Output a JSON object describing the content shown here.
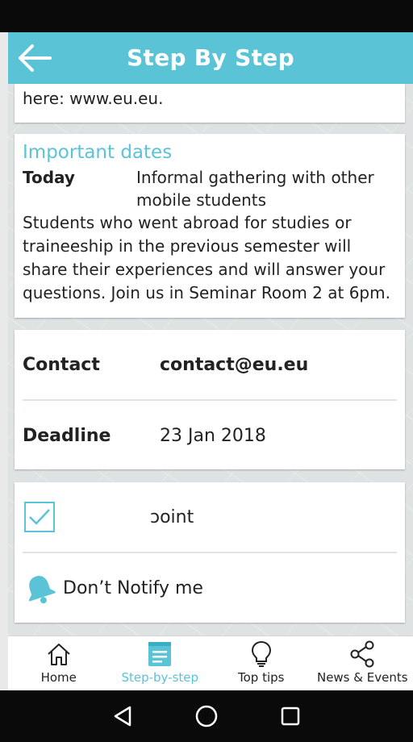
{
  "app_bar": {
    "title": "Step By Step",
    "back_icon": "arrow-left-icon"
  },
  "link_card": {
    "text": "here: www.eu.eu."
  },
  "important_dates": {
    "title": "Important dates",
    "items": [
      {
        "label": "Today",
        "event": "Informal gathering with other mobile students",
        "description": "Students who went abroad for studies or traineeship in the previous semester will share their experiences and will answer your questions. Join us in Seminar Room 2 at 6pm."
      }
    ]
  },
  "info": {
    "contact_label": "Contact",
    "contact_value": "contact@eu.eu",
    "deadline_label": "Deadline",
    "deadline_value": "23 Jan 2018"
  },
  "notify": {
    "checkbox_checked": true,
    "checkbox_text": "ɔoint",
    "dont_notify_label": "Don’t Notify me",
    "bell_icon": "bell-icon"
  },
  "bottom_nav": {
    "items": [
      {
        "label": "Home",
        "icon": "home-icon",
        "active": false
      },
      {
        "label": "Step-by-step",
        "icon": "document-icon",
        "active": true
      },
      {
        "label": "Top tips",
        "icon": "lightbulb-icon",
        "active": false
      },
      {
        "label": "News & Events",
        "icon": "share-icon",
        "active": false
      }
    ]
  },
  "colors": {
    "accent": "#5bc3d6",
    "text": "#222222",
    "system_bar": "#0a0a0a"
  }
}
